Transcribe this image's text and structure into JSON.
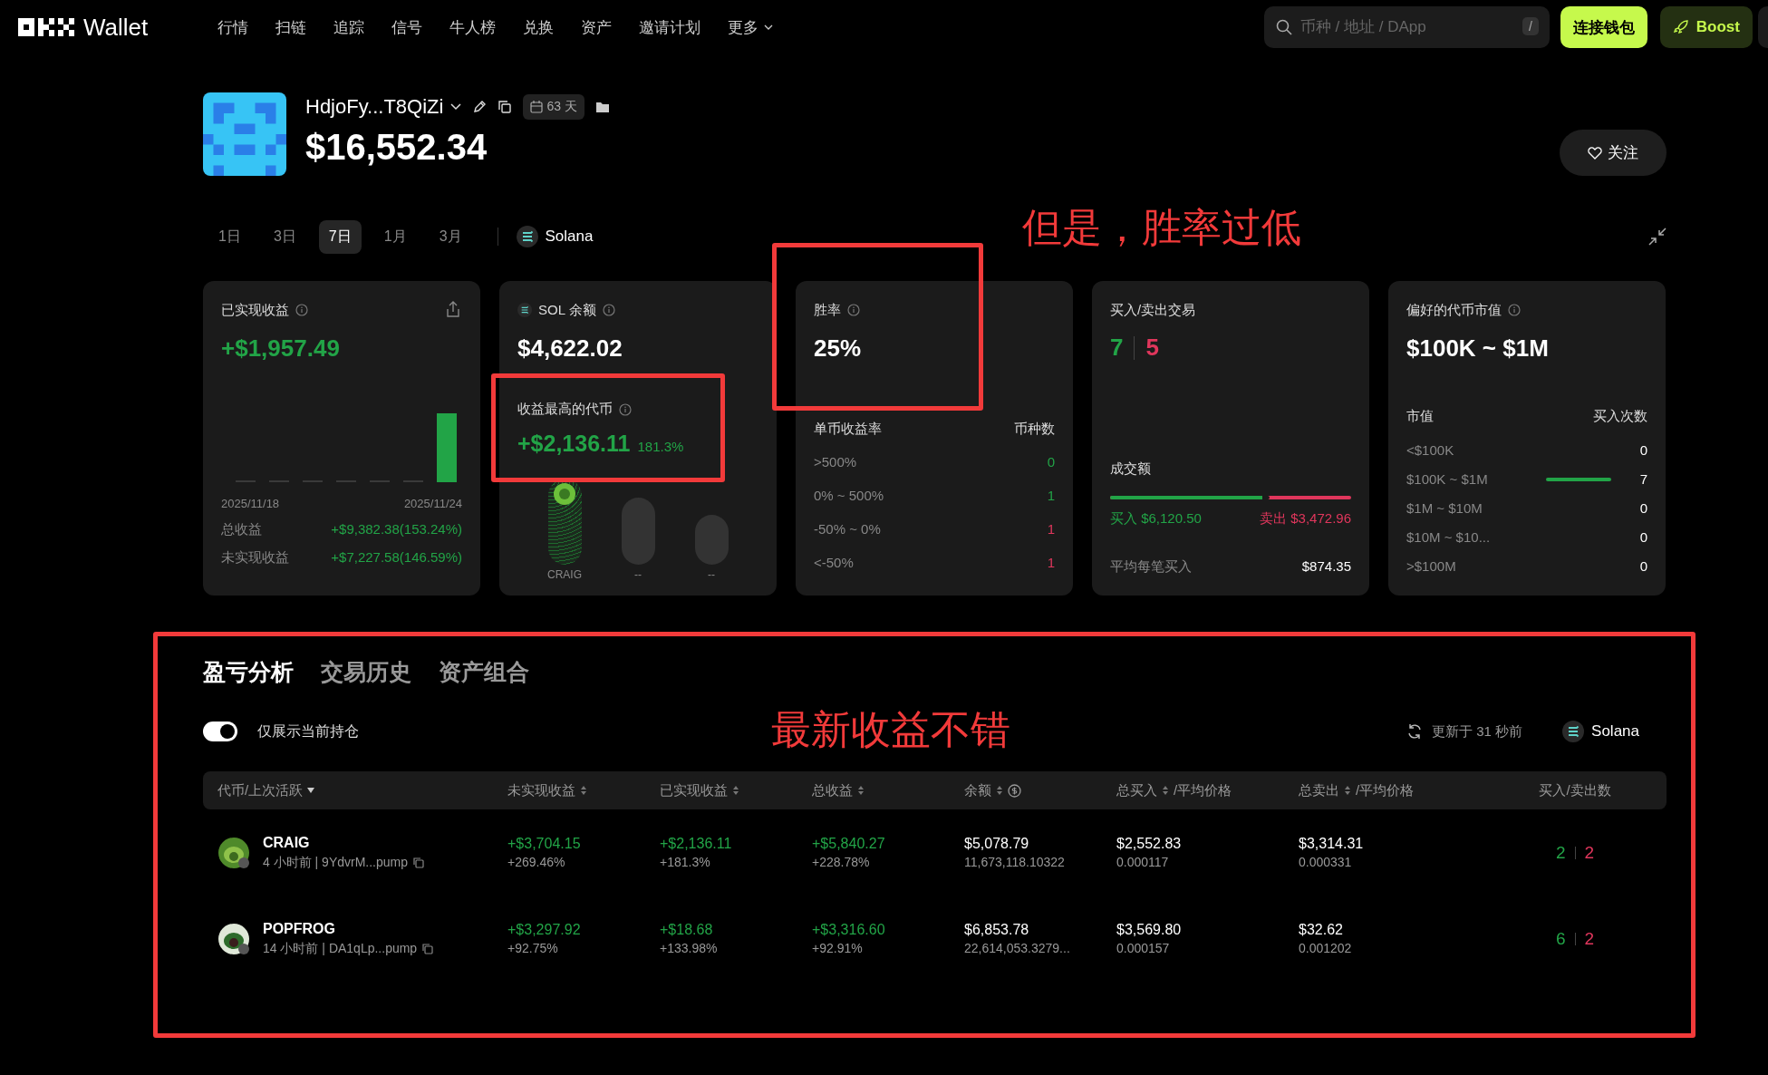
{
  "topbar": {
    "brand": "Wallet",
    "nav": [
      {
        "label": "行情"
      },
      {
        "label": "扫链"
      },
      {
        "label": "追踪"
      },
      {
        "label": "信号"
      },
      {
        "label": "牛人榜"
      },
      {
        "label": "兑换"
      },
      {
        "label": "资产"
      },
      {
        "label": "邀请计划"
      },
      {
        "label": "更多",
        "dropdown": true
      }
    ],
    "search": {
      "placeholder": "币种 / 地址 / DApp",
      "shortcut": "/"
    },
    "connect_button": "连接钱包",
    "boost_button": "Boost"
  },
  "wallet": {
    "name": "HdjoFy...T8QiZi",
    "age": "63 天",
    "balance": "$16,552.34",
    "follow_button": "关注"
  },
  "periods": [
    {
      "label": "1日",
      "selected": false
    },
    {
      "label": "3日",
      "selected": false
    },
    {
      "label": "7日",
      "selected": true
    },
    {
      "label": "1月",
      "selected": false
    },
    {
      "label": "3月",
      "selected": false
    }
  ],
  "chain": "Solana",
  "realized_card": {
    "title": "已实现收益",
    "value": "+$1,957.49",
    "start_date": "2025/11/18",
    "end_date": "2025/11/24",
    "rows": [
      {
        "label": "总收益",
        "value": "+$9,382.38(153.24%)"
      },
      {
        "label": "未实现收益",
        "value": "+$7,227.58(146.59%)"
      }
    ]
  },
  "sol_card": {
    "title": "SOL 余额",
    "value": "$4,622.02",
    "top_token_title": "收益最高的代币",
    "top_token_value": "+$2,136.11",
    "top_token_pct": "181.3%",
    "tokens": [
      {
        "label": "CRAIG",
        "selected": true
      },
      {
        "label": "--",
        "selected": false
      },
      {
        "label": "--",
        "selected": false
      }
    ]
  },
  "winrate_card": {
    "title": "胜率",
    "value": "25%",
    "col_1": "单币收益率",
    "col_2": "币种数",
    "rows": [
      {
        "range": ">500%",
        "count": "0",
        "color": "#22a447"
      },
      {
        "range": "0% ~ 500%",
        "count": "1",
        "color": "#22a447"
      },
      {
        "range": "-50% ~ 0%",
        "count": "1",
        "color": "#e0365c"
      },
      {
        "range": "<-50%",
        "count": "1",
        "color": "#e0365c"
      }
    ]
  },
  "trades_card": {
    "title": "买入/卖出交易",
    "buys": "7",
    "sells": "5",
    "volume_title": "成交额",
    "level": 0.63,
    "buy_label": "买入 $6,120.50",
    "sell_label": "卖出 $3,472.96",
    "avg_label": "平均每笔买入",
    "avg_value": "$874.35"
  },
  "mcap_card": {
    "title": "偏好的代币市值",
    "value": "$100K ~ $1M",
    "col_1": "市值",
    "col_2": "买入次数",
    "rows": [
      {
        "range": "<$100K",
        "count": "0"
      },
      {
        "range": "$100K ~ $1M",
        "count": "7",
        "level": 1
      },
      {
        "range": "$1M ~ $10M",
        "count": "0"
      },
      {
        "range": "$10M ~ $10...",
        "count": "0"
      },
      {
        "range": ">$100M",
        "count": "0"
      }
    ]
  },
  "section_tabs": [
    {
      "label": "盈亏分析",
      "selected": true
    },
    {
      "label": "交易历史",
      "selected": false
    },
    {
      "label": "资产组合",
      "selected": false
    }
  ],
  "holdings_toggle": {
    "label": "仅展示当前持仓",
    "on": true
  },
  "updated": "更新于 31 秒前",
  "table_chain": "Solana",
  "table": {
    "columns": [
      {
        "label": "代币/上次活跃",
        "kind": "caret"
      },
      {
        "label": "未实现收益",
        "kind": "sort"
      },
      {
        "label": "已实现收益",
        "kind": "sort"
      },
      {
        "label": "总收益",
        "kind": "sort"
      },
      {
        "label": "余额",
        "kind": "sort-coin"
      },
      {
        "label": "总买入",
        "kind": "sort",
        "suffix": "/平均价格"
      },
      {
        "label": "总卖出",
        "kind": "sort",
        "suffix": "/平均价格"
      },
      {
        "label": "买入/卖出数",
        "kind": "plain"
      }
    ],
    "rows": [
      {
        "token": "CRAIG",
        "meta": "4 小时前 | 9YdvrM...pump",
        "unrealized": "+$3,704.15",
        "unrealized_pct": "+269.46%",
        "realized": "+$2,136.11",
        "realized_pct": "+181.3%",
        "total": "+$5,840.27",
        "total_pct": "+228.78%",
        "balance": "$5,078.79",
        "balance_amount": "11,673,118.10322",
        "bought": "$2,552.83",
        "buy_price": "0.000117",
        "sold": "$3,314.31",
        "sell_price": "0.000331",
        "buys": "2",
        "sells": "2"
      },
      {
        "token": "POPFROG",
        "meta": "14 小时前 | DA1qLp...pump",
        "unrealized": "+$3,297.92",
        "unrealized_pct": "+92.75%",
        "realized": "+$18.68",
        "realized_pct": "+133.98%",
        "total": "+$3,316.60",
        "total_pct": "+92.91%",
        "balance": "$6,853.78",
        "balance_amount": "22,614,053.3279...",
        "bought": "$3,569.80",
        "buy_price": "0.000157",
        "sold": "$32.62",
        "sell_price": "0.001202",
        "buys": "6",
        "sells": "2"
      }
    ]
  },
  "annotations": [
    {
      "text": "但是，胜率过低"
    },
    {
      "text": "最新收益不错"
    }
  ]
}
